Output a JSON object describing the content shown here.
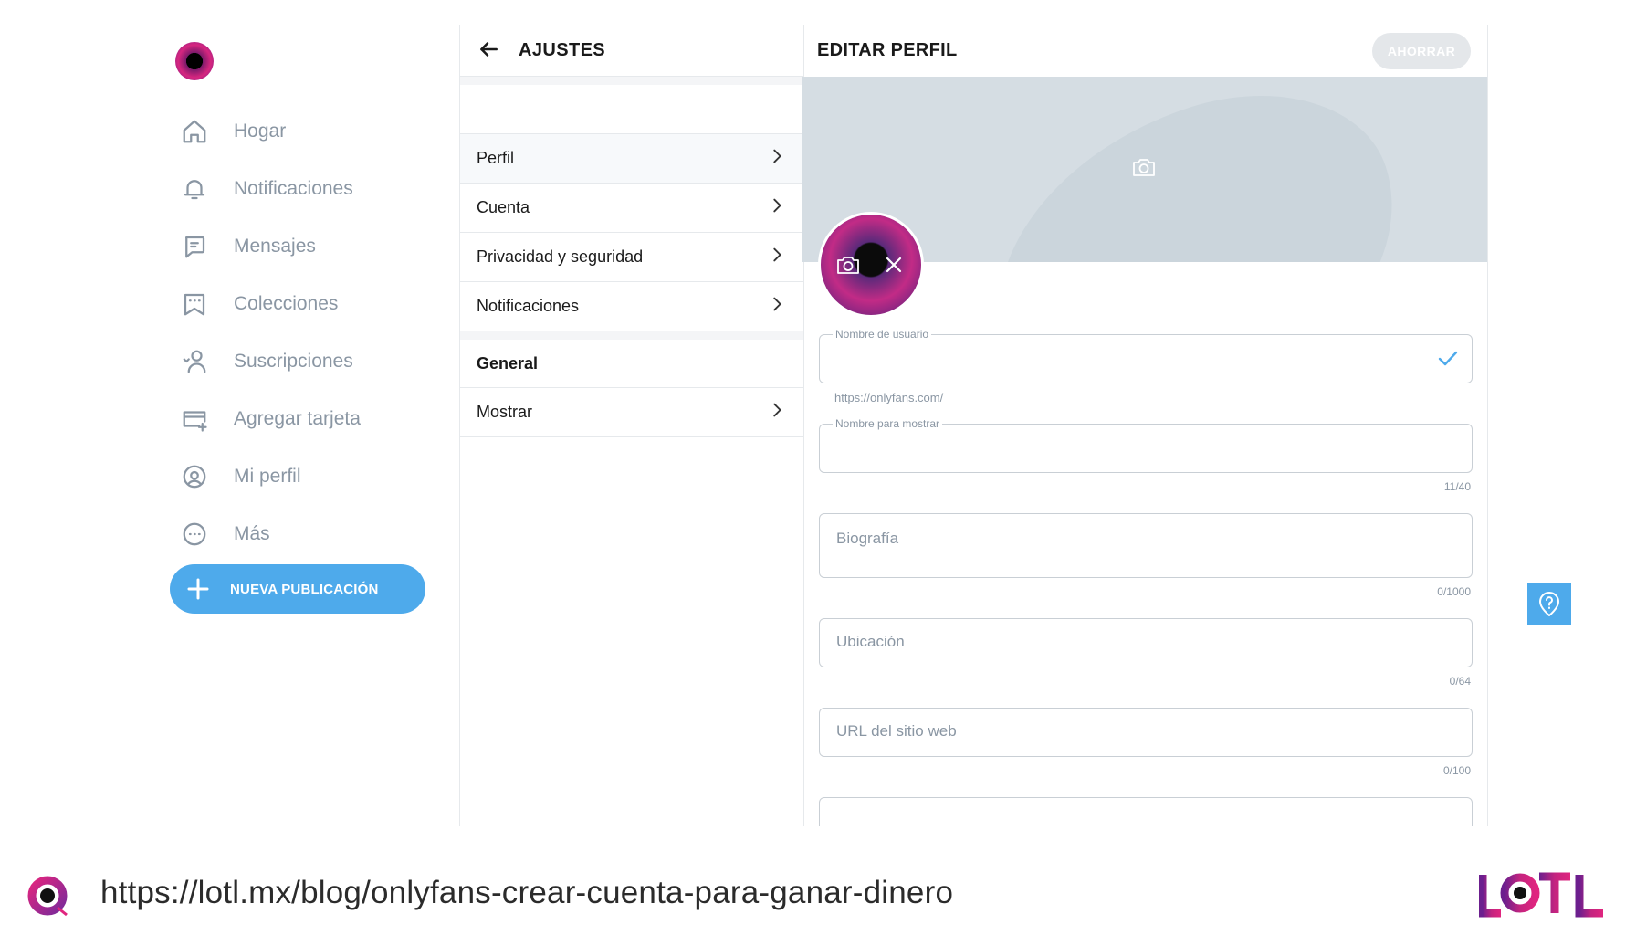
{
  "nav": {
    "items": [
      {
        "label": "Hogar",
        "icon": "home-icon"
      },
      {
        "label": "Notificaciones",
        "icon": "bell-icon"
      },
      {
        "label": "Mensajes",
        "icon": "message-icon"
      },
      {
        "label": "Colecciones",
        "icon": "bookmark-stars-icon"
      },
      {
        "label": "Suscripciones",
        "icon": "user-heart-icon"
      },
      {
        "label": "Agregar tarjeta",
        "icon": "credit-card-plus-icon"
      },
      {
        "label": "Mi perfil",
        "icon": "profile-circle-icon"
      },
      {
        "label": "Más",
        "icon": "more-dots-icon"
      }
    ],
    "new_post_label": "NUEVA PUBLICACIÓN"
  },
  "settings": {
    "title": "AJUSTES",
    "items": [
      {
        "label": "Perfil"
      },
      {
        "label": "Cuenta"
      },
      {
        "label": "Privacidad y seguridad"
      },
      {
        "label": "Notificaciones"
      }
    ],
    "section_general": "General",
    "general_items": [
      {
        "label": "Mostrar"
      }
    ]
  },
  "edit_profile": {
    "title": "EDITAR PERFIL",
    "save_label": "AHORRAR",
    "username_label": "Nombre de usuario",
    "username_hint": "https://onlyfans.com/",
    "display_name_label": "Nombre para mostrar",
    "display_name_counter": "11/40",
    "bio_placeholder": "Biografía",
    "bio_counter": "0/1000",
    "location_placeholder": "Ubicación",
    "location_counter": "0/64",
    "website_placeholder": "URL del sitio web",
    "website_counter": "0/100"
  },
  "footer": {
    "url": "https://lotl.mx/blog/onlyfans-crear-cuenta-para-ganar-dinero"
  },
  "colors": {
    "accent": "#4eaaeb",
    "muted_text": "#8a96a3",
    "brand_magenta": "#d6267f",
    "brand_purple": "#6c1f8e"
  }
}
